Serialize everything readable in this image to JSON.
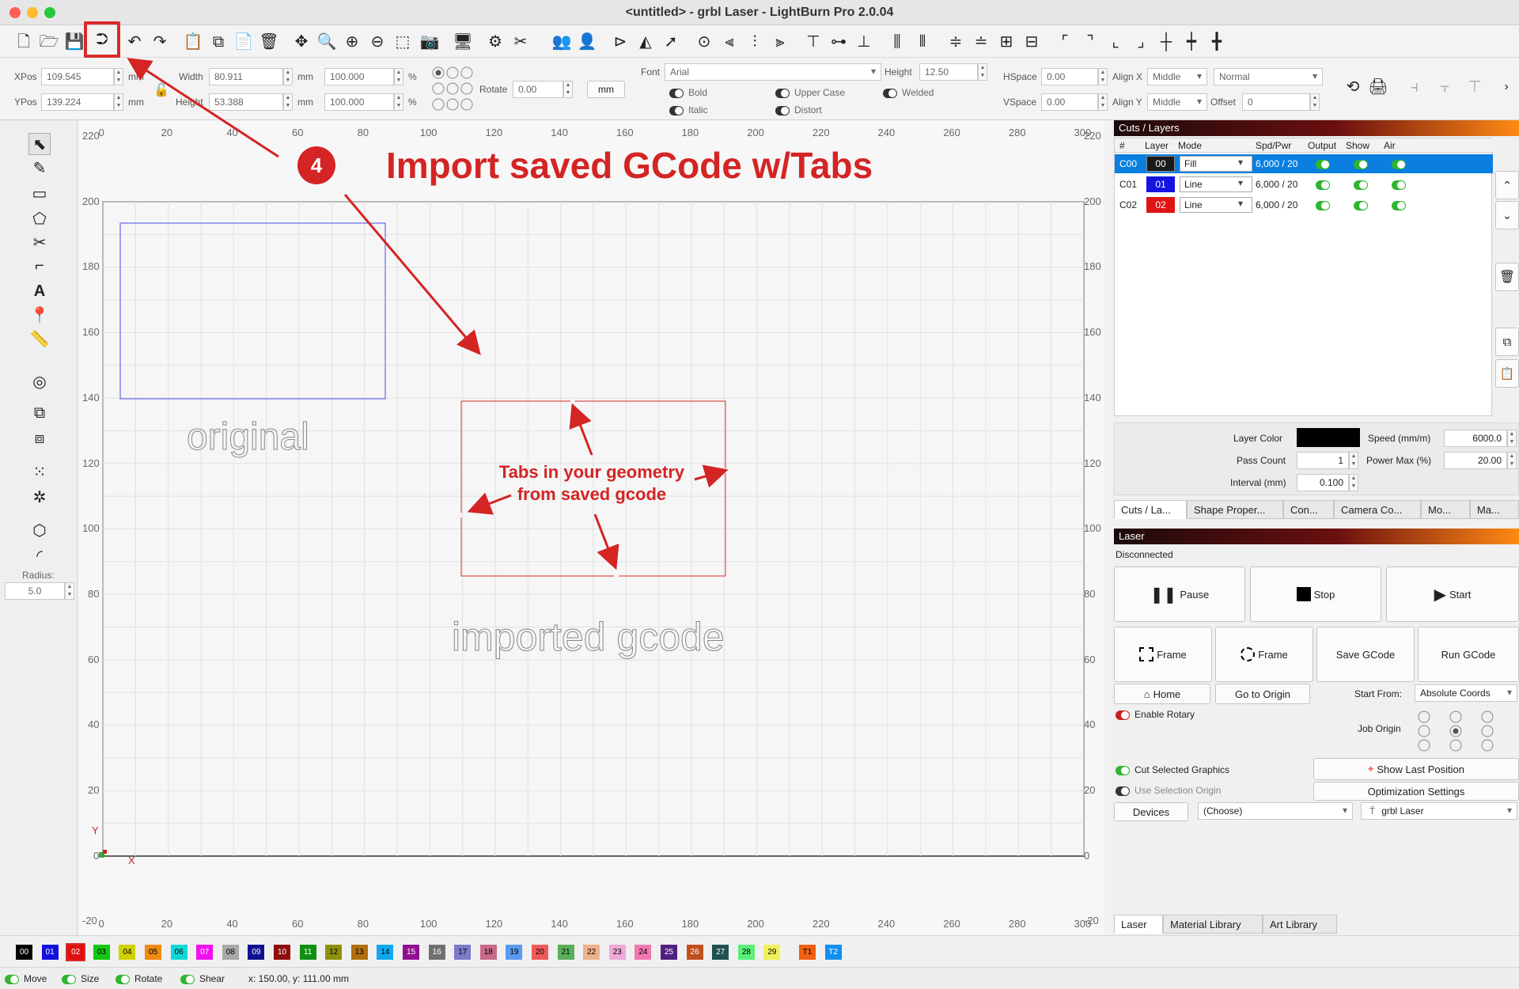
{
  "window": {
    "title": "<untitled> - grbl Laser - LightBurn Pro 2.0.04"
  },
  "toolbar": {
    "icons": [
      "new-file",
      "open",
      "save",
      "import",
      "undo",
      "redo",
      "clipboard-copy",
      "copy",
      "paste",
      "delete",
      "move",
      "zoom-fit",
      "zoom-in",
      "zoom-out",
      "zoom-frame",
      "camera",
      "monitor",
      "settings",
      "tools",
      "group",
      "user",
      "flip-h",
      "mirror",
      "send",
      "target",
      "align-left",
      "align-center",
      "align-right",
      "align-top",
      "align-middle",
      "align-bottom",
      "dist-h",
      "dist-v",
      "space-h",
      "space-v",
      "dock-a",
      "dock-b",
      "corner-tl",
      "corner-tr",
      "corner-bl",
      "corner-br",
      "cross-a",
      "cross-b",
      "cross-c"
    ]
  },
  "props": {
    "xpos_label": "XPos",
    "xpos": "109.545",
    "ypos_label": "YPos",
    "ypos": "139.224",
    "unit": "mm",
    "width_label": "Width",
    "width": "80.911",
    "height_label": "Height",
    "height": "53.388",
    "scale_w": "100.000",
    "scale_h": "100.000",
    "pct": "%",
    "rotate_label": "Rotate",
    "rotate": "0.00",
    "mm_button": "mm",
    "font_label": "Font",
    "font": "Arial",
    "fheight_label": "Height",
    "fheight": "12.50",
    "hspace_label": "HSpace",
    "hspace": "0.00",
    "vspace_label": "VSpace",
    "vspace": "0.00",
    "alignx_label": "Align X",
    "alignx": "Middle",
    "aligny_label": "Align Y",
    "aligny": "Middle",
    "normal": "Normal",
    "offset_label": "Offset",
    "offset": "0",
    "bold": "Bold",
    "italic": "Italic",
    "upper": "Upper Case",
    "distort": "Distort",
    "welded": "Welded"
  },
  "leftbar": {
    "radius_label": "Radius:",
    "radius": "5.0"
  },
  "ruler": {
    "top": [
      "0",
      "20",
      "40",
      "60",
      "80",
      "100",
      "120",
      "140",
      "160",
      "180",
      "200",
      "220",
      "240",
      "260",
      "280",
      "300"
    ],
    "left": [
      "220",
      "200",
      "180",
      "160",
      "140",
      "120",
      "100",
      "80",
      "60",
      "40",
      "20",
      "0",
      "-20"
    ],
    "right": [
      "220",
      "200",
      "180",
      "160",
      "140",
      "120",
      "100",
      "80",
      "60",
      "40",
      "20",
      "0",
      "-20"
    ],
    "origin_y": "Y",
    "origin_x": "X"
  },
  "canvas": {
    "original_label": "original",
    "imported_label": "imported gcode"
  },
  "annotations": {
    "step": "4",
    "headline": "Import saved GCode w/Tabs",
    "tabs_note_1": "Tabs in your geometry",
    "tabs_note_2": "from saved gcode"
  },
  "cuts": {
    "header": "Cuts / Layers",
    "cols": [
      "#",
      "Layer",
      "Mode",
      "Spd/Pwr",
      "Output",
      "Show",
      "Air"
    ],
    "rows": [
      {
        "id": "C00",
        "layer": "00",
        "color": "#1a1a1a",
        "mode": "Fill",
        "spd": "6,000 / 20",
        "selected": true
      },
      {
        "id": "C01",
        "layer": "01",
        "color": "#1414e0",
        "mode": "Line",
        "spd": "6,000 / 20",
        "selected": false
      },
      {
        "id": "C02",
        "layer": "02",
        "color": "#e01414",
        "mode": "Line",
        "spd": "6,000 / 20",
        "selected": false
      }
    ],
    "layer_color_label": "Layer Color",
    "speed_label": "Speed (mm/m)",
    "speed": "6000.0",
    "pass_label": "Pass Count",
    "pass": "1",
    "power_label": "Power Max (%)",
    "power": "20.00",
    "interval_label": "Interval (mm)",
    "interval": "0.100",
    "tabs": [
      "Cuts / La...",
      "Shape Proper...",
      "Con...",
      "Camera Co...",
      "Mo...",
      "Ma..."
    ]
  },
  "laser": {
    "header": "Laser",
    "status": "Disconnected",
    "pause": "Pause",
    "stop": "Stop",
    "start": "Start",
    "frame1": "Frame",
    "frame2": "Frame",
    "save_gcode": "Save GCode",
    "run_gcode": "Run GCode",
    "home": "Home",
    "goto_origin": "Go to Origin",
    "start_from_label": "Start From:",
    "start_from": "Absolute Coords",
    "enable_rotary": "Enable Rotary",
    "job_origin": "Job Origin",
    "cut_selected": "Cut Selected Graphics",
    "use_selection_origin": "Use Selection Origin",
    "show_last": "Show Last Position",
    "optimization": "Optimization Settings",
    "devices": "Devices",
    "choose": "(Choose)",
    "device": "grbl Laser",
    "bottom_tabs": [
      "Laser",
      "Material Library",
      "Art Library"
    ]
  },
  "palette": [
    {
      "l": "00",
      "c": "#000000",
      "t": "#ffffff"
    },
    {
      "l": "01",
      "c": "#1010e0",
      "t": "#ffffff"
    },
    {
      "l": "02",
      "c": "#e01010",
      "t": "#ffffff"
    },
    {
      "l": "03",
      "c": "#10c810",
      "t": "#000000"
    },
    {
      "l": "04",
      "c": "#d2d200",
      "t": "#000000"
    },
    {
      "l": "05",
      "c": "#f08a10",
      "t": "#000000"
    },
    {
      "l": "06",
      "c": "#10d8d8",
      "t": "#000000"
    },
    {
      "l": "07",
      "c": "#f010f0",
      "t": "#ffffff"
    },
    {
      "l": "08",
      "c": "#a8a8a8",
      "t": "#000000"
    },
    {
      "l": "09",
      "c": "#101090",
      "t": "#ffffff"
    },
    {
      "l": "10",
      "c": "#900e0e",
      "t": "#ffffff"
    },
    {
      "l": "11",
      "c": "#109010",
      "t": "#ffffff"
    },
    {
      "l": "12",
      "c": "#909010",
      "t": "#000000"
    },
    {
      "l": "13",
      "c": "#b07010",
      "t": "#000000"
    },
    {
      "l": "14",
      "c": "#10a8f0",
      "t": "#000000"
    },
    {
      "l": "15",
      "c": "#901090",
      "t": "#ffffff"
    },
    {
      "l": "16",
      "c": "#707070",
      "t": "#ffffff"
    },
    {
      "l": "17",
      "c": "#7a7ac8",
      "t": "#000000"
    },
    {
      "l": "18",
      "c": "#c86a8a",
      "t": "#000000"
    },
    {
      "l": "19",
      "c": "#5a9af0",
      "t": "#000000"
    },
    {
      "l": "20",
      "c": "#f05a5a",
      "t": "#000000"
    },
    {
      "l": "21",
      "c": "#5ab05a",
      "t": "#000000"
    },
    {
      "l": "22",
      "c": "#f0b08a",
      "t": "#000000"
    },
    {
      "l": "23",
      "c": "#f0a8d8",
      "t": "#000000"
    },
    {
      "l": "24",
      "c": "#f078b0",
      "t": "#000000"
    },
    {
      "l": "25",
      "c": "#502080",
      "t": "#ffffff"
    },
    {
      "l": "26",
      "c": "#c05020",
      "t": "#ffffff"
    },
    {
      "l": "27",
      "c": "#205050",
      "t": "#ffffff"
    },
    {
      "l": "28",
      "c": "#5af078",
      "t": "#000000"
    },
    {
      "l": "29",
      "c": "#f0f05a",
      "t": "#000000"
    },
    {
      "l": "T1",
      "c": "#f06010",
      "t": "#000000"
    },
    {
      "l": "T2",
      "c": "#1090f0",
      "t": "#ffffff"
    }
  ],
  "status": {
    "move": "Move",
    "size": "Size",
    "rotate": "Rotate",
    "shear": "Shear",
    "coords": "x: 150.00, y: 111.00 mm"
  }
}
